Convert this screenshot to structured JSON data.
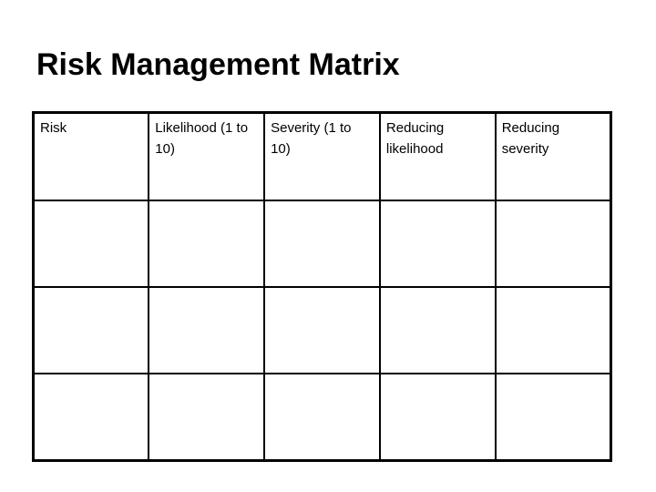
{
  "slide": {
    "title": "Risk Management Matrix",
    "background_color": "#ffffff",
    "text_color": "#000000",
    "border_color": "#000000"
  },
  "matrix": {
    "columns": [
      {
        "id": "risk",
        "label": "Risk"
      },
      {
        "id": "likelihood",
        "label": "Likelihood (1 to 10)"
      },
      {
        "id": "severity",
        "label": "Severity (1 to 10)"
      },
      {
        "id": "reducing-likelihood",
        "label": "Reducing likelihood"
      },
      {
        "id": "reducing-severity",
        "label": "Reducing severity"
      }
    ],
    "rows": [
      {
        "risk": "",
        "likelihood": "",
        "severity": "",
        "reducing_likelihood": "",
        "reducing_severity": ""
      },
      {
        "risk": "",
        "likelihood": "",
        "severity": "",
        "reducing_likelihood": "",
        "reducing_severity": ""
      },
      {
        "risk": "",
        "likelihood": "",
        "severity": "",
        "reducing_likelihood": "",
        "reducing_severity": ""
      }
    ]
  }
}
